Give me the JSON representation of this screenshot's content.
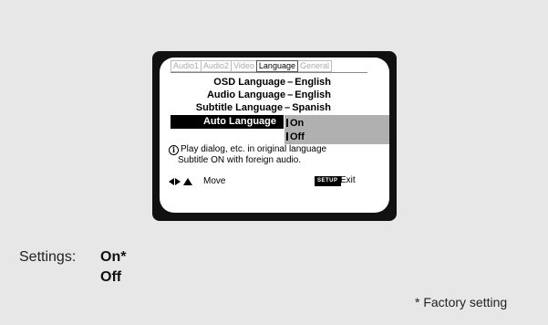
{
  "screen": {
    "tabs": [
      "Audio1",
      "Audio2",
      "Video",
      "Language",
      "General"
    ],
    "active_tab_index": 3,
    "rows": [
      {
        "label": "OSD Language",
        "value": "English"
      },
      {
        "label": "Audio Language",
        "value": "English"
      },
      {
        "label": "Subtitle Language",
        "value": "Spanish"
      }
    ],
    "dash": "–",
    "selected_label": "Auto Language",
    "options": [
      "On",
      "Off"
    ],
    "info_icon": "info-icon",
    "info_line1": "Play dialog, etc. in original language",
    "info_line2": "Subtitle ON with foreign audio.",
    "nav_label": "Move",
    "setup_badge": "SETUP",
    "exit_label": "Exit"
  },
  "settings": {
    "label": "Settings:",
    "values": [
      "On*",
      "Off"
    ]
  },
  "footnote": "* Factory setting",
  "colors": {
    "page_background": "#e7e7e7",
    "screen_background": "#ffffff",
    "frame": "#111111",
    "highlight_panel": "#b0b0b0",
    "selected_label_background": "#000000"
  }
}
